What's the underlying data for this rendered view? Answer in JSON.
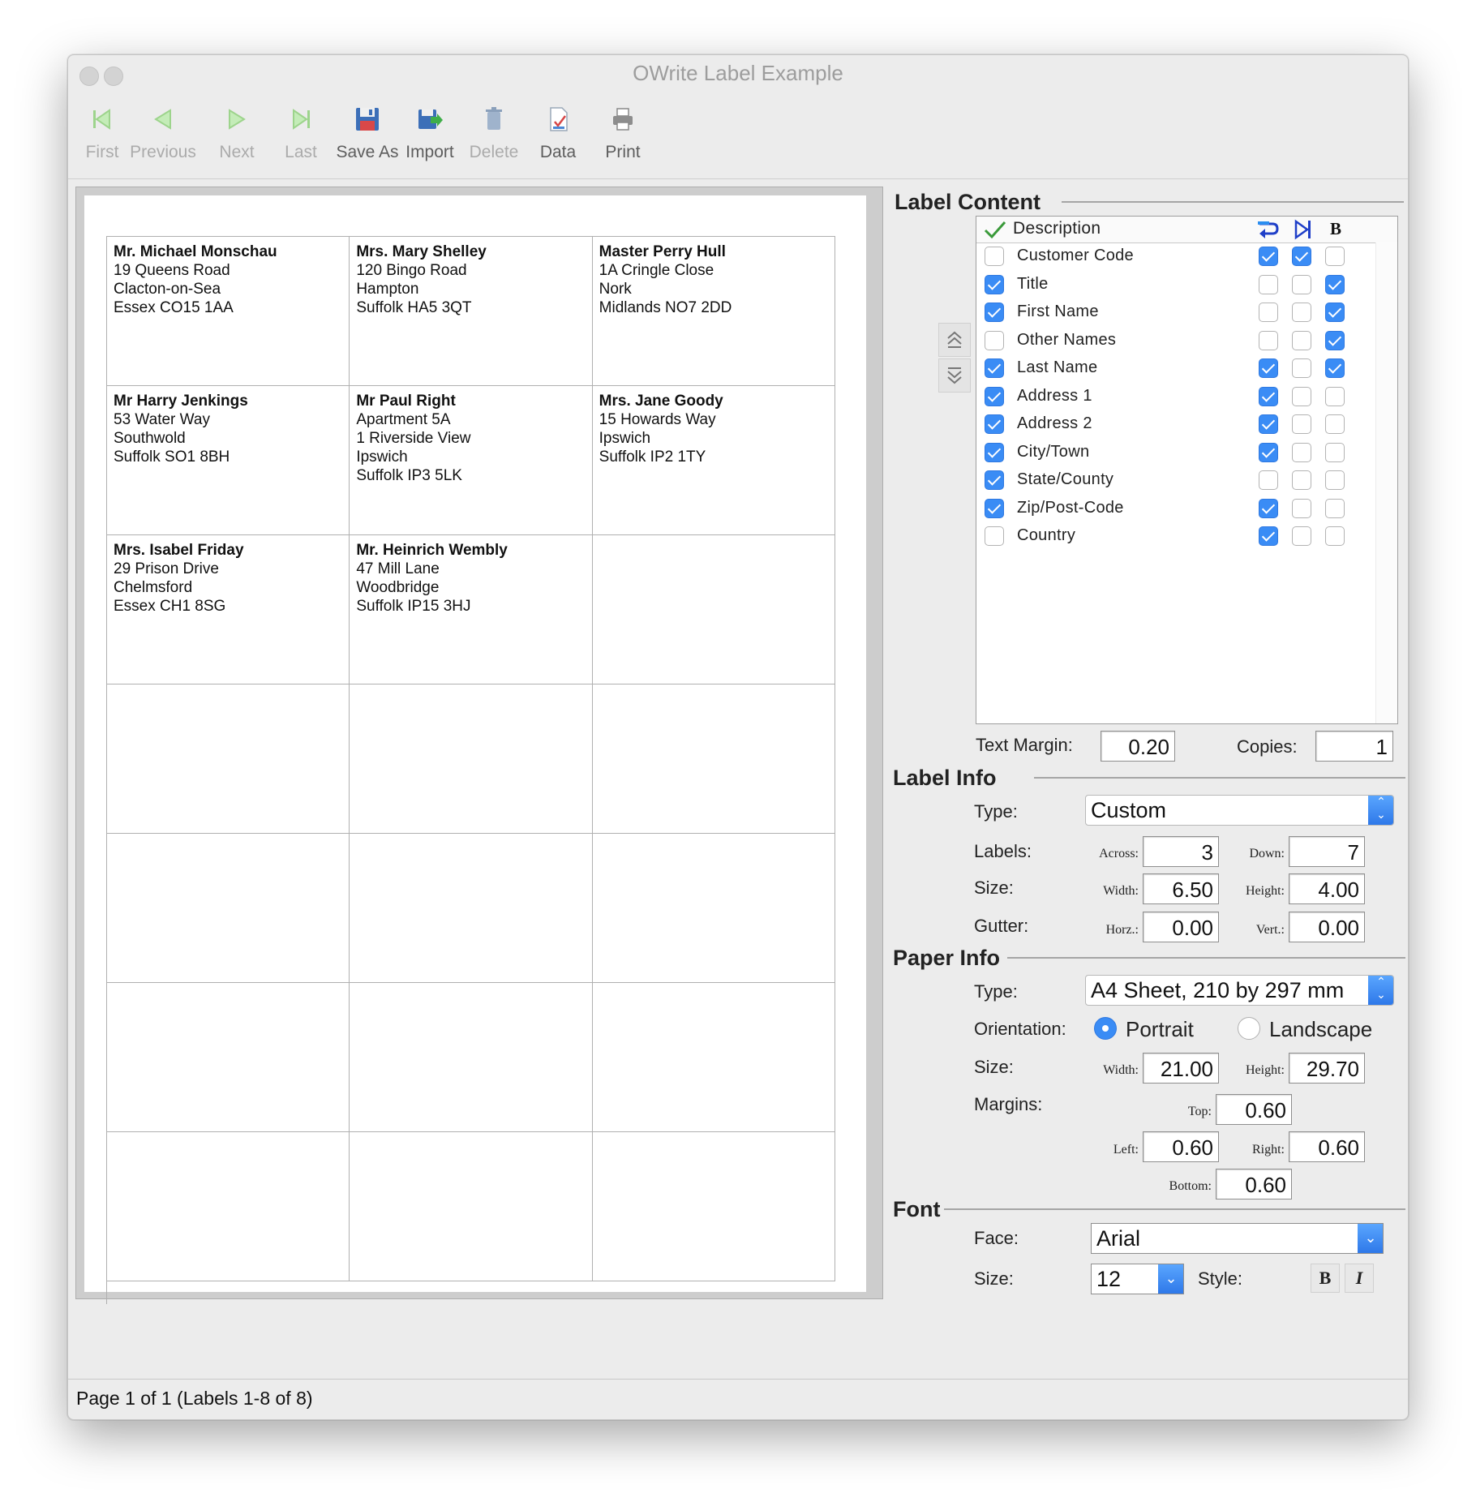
{
  "window": {
    "title": "OWrite Label Example"
  },
  "toolbar": {
    "first": "First",
    "previous": "Previous",
    "next": "Next",
    "last": "Last",
    "save_as": "Save As",
    "import": "Import",
    "delete": "Delete",
    "data": "Data",
    "print": "Print"
  },
  "labels": [
    {
      "name": "Mr. Michael Monschau",
      "lines": [
        "19 Queens Road",
        "Clacton-on-Sea",
        "Essex CO15 1AA"
      ]
    },
    {
      "name": "Mrs. Mary Shelley",
      "lines": [
        "120 Bingo Road",
        "Hampton",
        "Suffolk HA5 3QT"
      ]
    },
    {
      "name": "Master Perry Hull",
      "lines": [
        "1A Cringle Close",
        "Nork",
        "Midlands NO7 2DD"
      ]
    },
    {
      "name": "Mr Harry Jenkings",
      "lines": [
        "53 Water Way",
        "Southwold",
        "Suffolk SO1 8BH"
      ]
    },
    {
      "name": "Mr Paul Right",
      "lines": [
        "Apartment 5A",
        "1 Riverside View",
        "Ipswich",
        "Suffolk IP3 5LK"
      ]
    },
    {
      "name": "Mrs. Jane Goody",
      "lines": [
        "15 Howards Way",
        "Ipswich",
        "Suffolk IP2 1TY"
      ]
    },
    {
      "name": "Mrs. Isabel Friday",
      "lines": [
        "29 Prison Drive",
        "Chelmsford",
        "Essex CH1 8SG"
      ]
    },
    {
      "name": "Mr. Heinrich Wembly",
      "lines": [
        "47 Mill Lane",
        "Woodbridge",
        "Suffolk IP15 3HJ"
      ]
    }
  ],
  "label_content": {
    "heading": "Label Content",
    "column_description": "Description",
    "column_bold_glyph": "B",
    "fields": [
      {
        "name": "Customer Code",
        "include": false,
        "newline": true,
        "tab": true,
        "bold": false
      },
      {
        "name": "Title",
        "include": true,
        "newline": false,
        "tab": false,
        "bold": true
      },
      {
        "name": "First Name",
        "include": true,
        "newline": false,
        "tab": false,
        "bold": true
      },
      {
        "name": "Other Names",
        "include": false,
        "newline": false,
        "tab": false,
        "bold": true
      },
      {
        "name": "Last Name",
        "include": true,
        "newline": true,
        "tab": false,
        "bold": true
      },
      {
        "name": "Address 1",
        "include": true,
        "newline": true,
        "tab": false,
        "bold": false
      },
      {
        "name": "Address 2",
        "include": true,
        "newline": true,
        "tab": false,
        "bold": false
      },
      {
        "name": "City/Town",
        "include": true,
        "newline": true,
        "tab": false,
        "bold": false
      },
      {
        "name": "State/County",
        "include": true,
        "newline": false,
        "tab": false,
        "bold": false
      },
      {
        "name": "Zip/Post-Code",
        "include": true,
        "newline": true,
        "tab": false,
        "bold": false
      },
      {
        "name": "Country",
        "include": false,
        "newline": true,
        "tab": false,
        "bold": false
      }
    ],
    "text_margin_label": "Text Margin:",
    "text_margin": "0.20",
    "copies_label": "Copies:",
    "copies": "1"
  },
  "label_info": {
    "heading": "Label Info",
    "type_label": "Type:",
    "type": "Custom",
    "labels_label": "Labels:",
    "across_label": "Across:",
    "across": "3",
    "down_label": "Down:",
    "down": "7",
    "size_label": "Size:",
    "width_label": "Width:",
    "width": "6.50",
    "height_label": "Height:",
    "height": "4.00",
    "gutter_label": "Gutter:",
    "horz_label": "Horz.:",
    "horz": "0.00",
    "vert_label": "Vert.:",
    "vert": "0.00"
  },
  "paper_info": {
    "heading": "Paper Info",
    "type_label": "Type:",
    "type": "A4 Sheet, 210 by 297 mm",
    "orientation_label": "Orientation:",
    "portrait": "Portrait",
    "landscape": "Landscape",
    "orientation_selected": "Portrait",
    "size_label": "Size:",
    "width_label": "Width:",
    "width": "21.00",
    "height_label": "Height:",
    "height": "29.70",
    "margins_label": "Margins:",
    "top_label": "Top:",
    "top": "0.60",
    "left_label": "Left:",
    "left": "0.60",
    "right_label": "Right:",
    "right": "0.60",
    "bottom_label": "Bottom:",
    "bottom": "0.60"
  },
  "font": {
    "heading": "Font",
    "face_label": "Face:",
    "face": "Arial",
    "size_label": "Size:",
    "size": "12",
    "style_label": "Style:",
    "bold_glyph": "B",
    "italic_glyph": "I"
  },
  "status": {
    "text": "Page 1 of 1 (Labels 1-8 of 8)"
  },
  "colors": {
    "accent": "#3a8cf5",
    "nav_icon": "#9fd88f",
    "window_bg": "#ececec"
  }
}
